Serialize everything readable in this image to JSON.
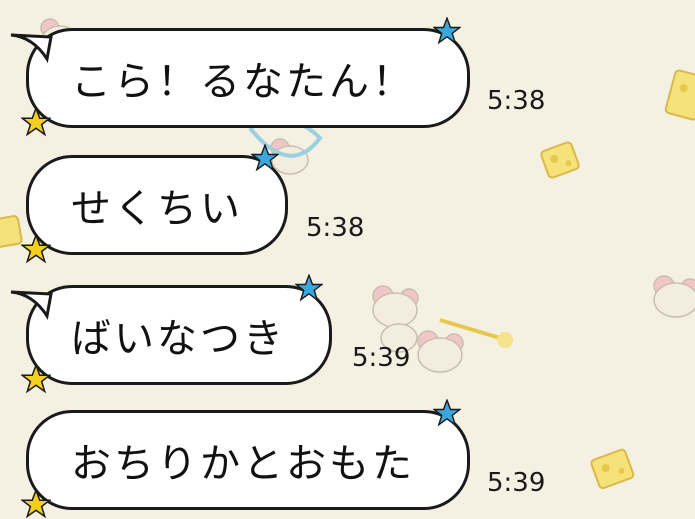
{
  "chat": {
    "messages": [
      {
        "text": "こら！るなたん！",
        "time": "5:38"
      },
      {
        "text": "せくちい",
        "time": "5:38"
      },
      {
        "text": "ばいなつき",
        "time": "5:39"
      },
      {
        "text": "おちりかとおもた",
        "time": "5:39"
      }
    ]
  },
  "colors": {
    "background": "#f4f0e2",
    "bubble": "#ffffff",
    "outline": "#1a1a1a",
    "star_blue": "#3aa7dd",
    "star_yellow": "#f4cf1e"
  },
  "icons": {
    "top_star": "blue-star-icon",
    "bottom_star": "yellow-star-icon",
    "wallpaper": "mouse-and-cheese-pattern"
  }
}
